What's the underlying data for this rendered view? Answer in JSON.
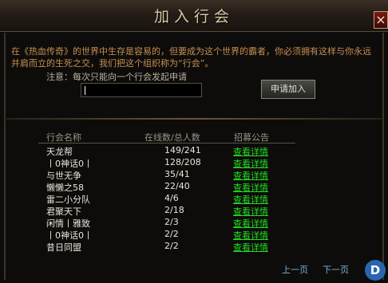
{
  "window": {
    "title": "加入行会",
    "close_label": "×"
  },
  "intro": {
    "text": "在《热血传奇》的世界中生存是容易的，但要成为这个世界的霸者，你必须拥有这样与你永远并肩而立的生死之交，我们把这个组织称为“行会”。",
    "note": "注意：每次只能向一个行会发起申请"
  },
  "join": {
    "input_value": "",
    "button_label": "申请加入"
  },
  "table": {
    "headers": [
      "行会名称",
      "在线数/总人数",
      "招募公告"
    ],
    "rows": [
      {
        "name": "天龙帮",
        "count": "149/241",
        "link": "查看详情"
      },
      {
        "name": "丨0神话0丨",
        "count": "128/208",
        "link": "查看详情"
      },
      {
        "name": "与世无争",
        "count": "35/41",
        "link": "查看详情"
      },
      {
        "name": "懒懒之58",
        "count": "22/40",
        "link": "查看详情"
      },
      {
        "name": "雷二小分队",
        "count": "4/6",
        "link": "查看详情"
      },
      {
        "name": "君聚天下",
        "count": "2/18",
        "link": "查看详情"
      },
      {
        "name": "闲情丨雅致",
        "count": "2/3",
        "link": "查看详情"
      },
      {
        "name": "丨0神话0丨",
        "count": "2/2",
        "link": "查看详情"
      },
      {
        "name": "昔日同盟",
        "count": "2/2",
        "link": "查看详情"
      }
    ]
  },
  "pager": {
    "prev_label": "上一页",
    "next_label": "下一页"
  },
  "colors": {
    "link": "#22dd22",
    "intro_text": "#c98f52",
    "title_text": "#d9c9a8"
  },
  "icons": {
    "close": "close-icon",
    "watermark": "site-logo-icon"
  }
}
